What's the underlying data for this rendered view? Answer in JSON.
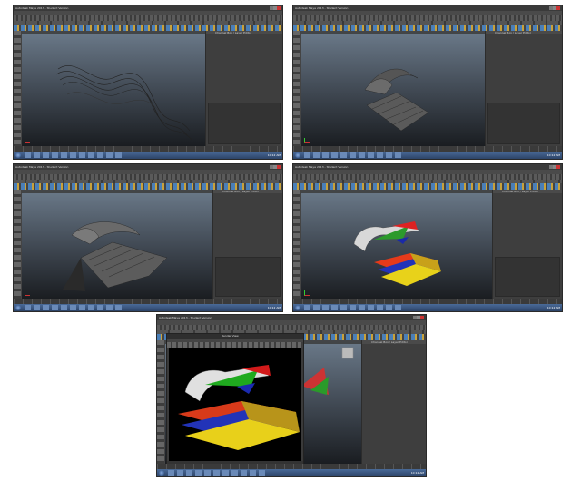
{
  "app": {
    "window_title": "Autodesk Maya 2013 - Student Version",
    "menus": [
      "File",
      "Edit",
      "Modify",
      "Create",
      "Display",
      "Window",
      "Assets",
      "Edit Curves",
      "Surfaces",
      "Edit NURBS",
      "Polygons",
      "Help"
    ],
    "shelf_tabs": [
      "General",
      "Curves",
      "Surfaces",
      "Polygons",
      "Subdivs",
      "Deformation",
      "Animation",
      "Dynamics",
      "Rendering",
      "PaintEffects",
      "Toon",
      "Muscle",
      "Fluids",
      "Fur",
      "Hair",
      "nCloth",
      "Custom"
    ],
    "side_panel_title": "Channel Box / Layer Editor",
    "side_panel_tabs": [
      "Channels",
      "Edit",
      "Object",
      "Show"
    ],
    "colors": {
      "ui_dark": "#444444",
      "viewport_top": "#6b7a8a",
      "viewport_bottom": "#1a1d21",
      "taskbar": "#2c4468"
    }
  },
  "panels": [
    {
      "step": 1,
      "content": "Curves drawn in perspective view"
    },
    {
      "step": 2,
      "content": "Lofted surfaces"
    },
    {
      "step": 3,
      "content": "Extruded surfaces"
    },
    {
      "step": 4,
      "content": "Colored shaders applied"
    },
    {
      "step": 5,
      "content": "Render View"
    }
  ],
  "render_view": {
    "title": "Render View",
    "menu": [
      "File",
      "View",
      "Render",
      "IPR",
      "Options",
      "Display",
      "Show",
      "Help"
    ],
    "caption": "Frame: 1   Render Time: 0:01   Camera: persp"
  },
  "taskbar": {
    "clock": "10:12 AM"
  }
}
